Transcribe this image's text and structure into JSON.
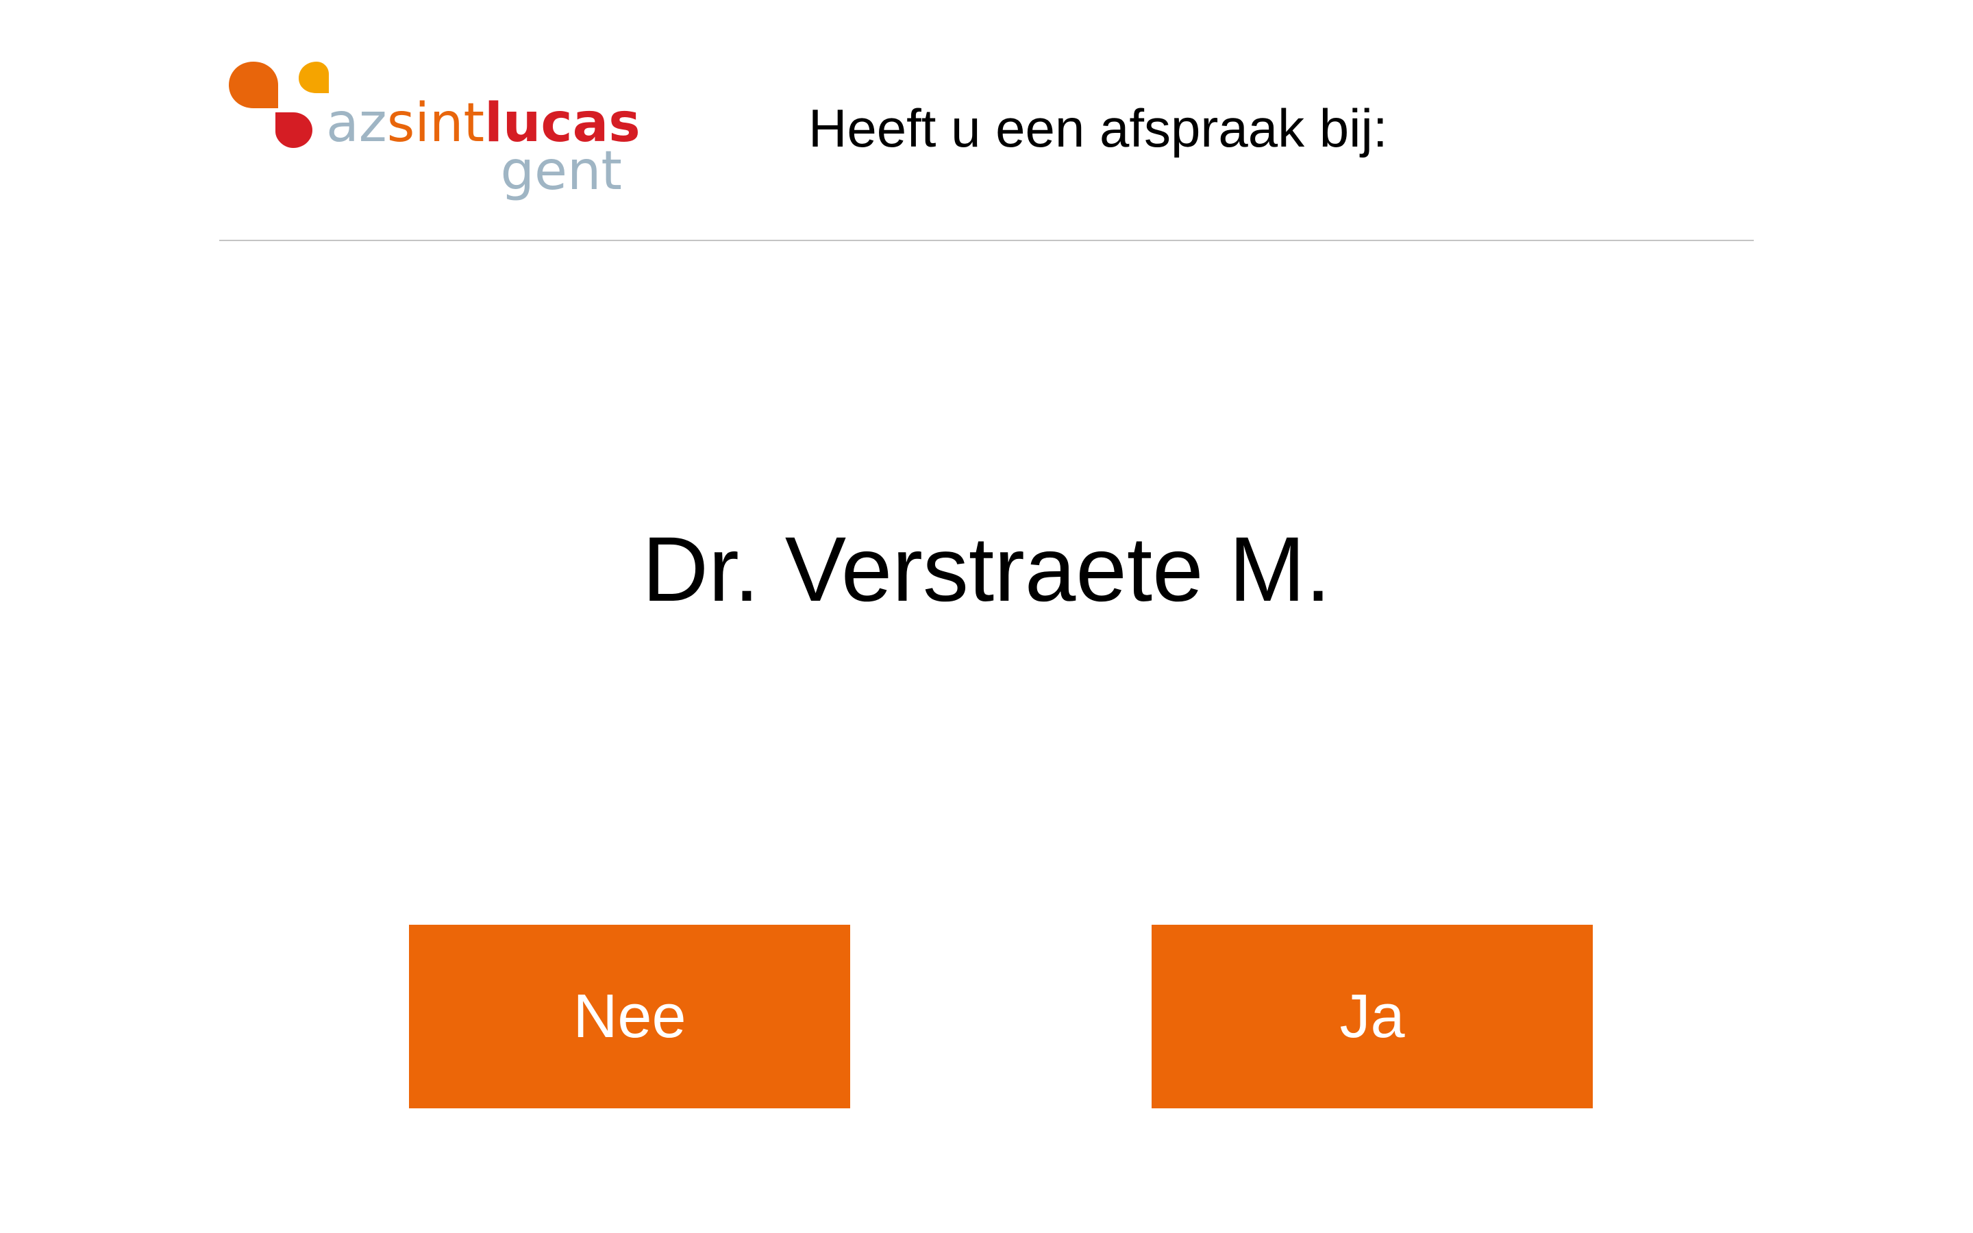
{
  "header": {
    "logo": {
      "wordmark_az": "az",
      "wordmark_sint": "sint",
      "wordmark_lucas": "lucas",
      "wordmark_city": "gent",
      "colors": {
        "orange": "#e8650b",
        "yellow": "#f5a400",
        "red": "#d51d24",
        "grey_blue": "#9fb5c4"
      }
    },
    "prompt": "Heeft u een afspraak bij:"
  },
  "main": {
    "doctor_name": "Dr. Verstraete M."
  },
  "actions": {
    "no_label": "Nee",
    "yes_label": "Ja",
    "button_color": "#ec6608"
  }
}
